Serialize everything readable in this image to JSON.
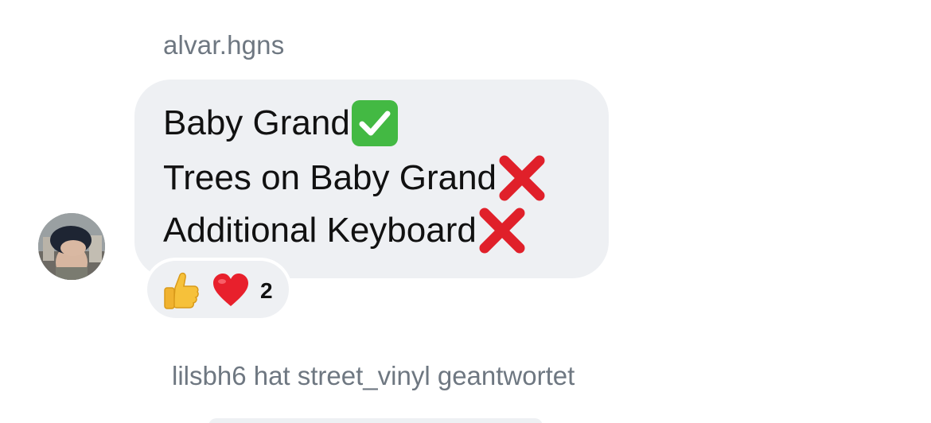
{
  "message": {
    "sender": "alvar.hgns",
    "lines": [
      {
        "text": "Baby Grand",
        "emoji": "check-mark-button"
      },
      {
        "text": "Trees on Baby Grand",
        "emoji": "cross-mark"
      },
      {
        "text": "Additional Keyboard",
        "emoji": "cross-mark"
      }
    ],
    "bubble_color": "#eef0f3"
  },
  "reactions": {
    "emojis": [
      "thumbs-up",
      "red-heart"
    ],
    "count": "2"
  },
  "reply_note": "lilsbh6 hat street_vinyl geantwortet",
  "colors": {
    "meta_text": "#6e7781",
    "body_text": "#111111",
    "check_green": "#43b943",
    "cross_red": "#e0202a",
    "heart_red": "#e8202c"
  }
}
